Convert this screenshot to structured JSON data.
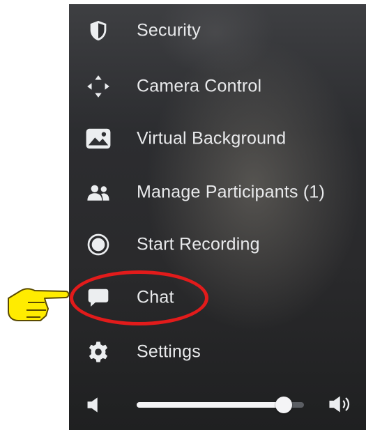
{
  "menu": {
    "items": [
      {
        "id": "security",
        "label": "Security",
        "icon": "shield-icon"
      },
      {
        "id": "camera-control",
        "label": "Camera Control",
        "icon": "move-arrows-icon"
      },
      {
        "id": "virtual-background",
        "label": "Virtual Background",
        "icon": "image-icon"
      },
      {
        "id": "manage-participants",
        "label": "Manage Participants (1)",
        "icon": "participants-icon"
      },
      {
        "id": "start-recording",
        "label": "Start Recording",
        "icon": "record-icon"
      },
      {
        "id": "chat",
        "label": "Chat",
        "icon": "chat-bubble-icon"
      },
      {
        "id": "settings",
        "label": "Settings",
        "icon": "gear-icon"
      }
    ]
  },
  "volume": {
    "level_fraction": 0.88,
    "low_icon": "speaker-low-icon",
    "high_icon": "speaker-high-icon"
  },
  "annotation": {
    "highlight_color": "#e21b1b",
    "pointer_color": "#ffec00",
    "pointer_icon": "pointing-hand-icon"
  }
}
